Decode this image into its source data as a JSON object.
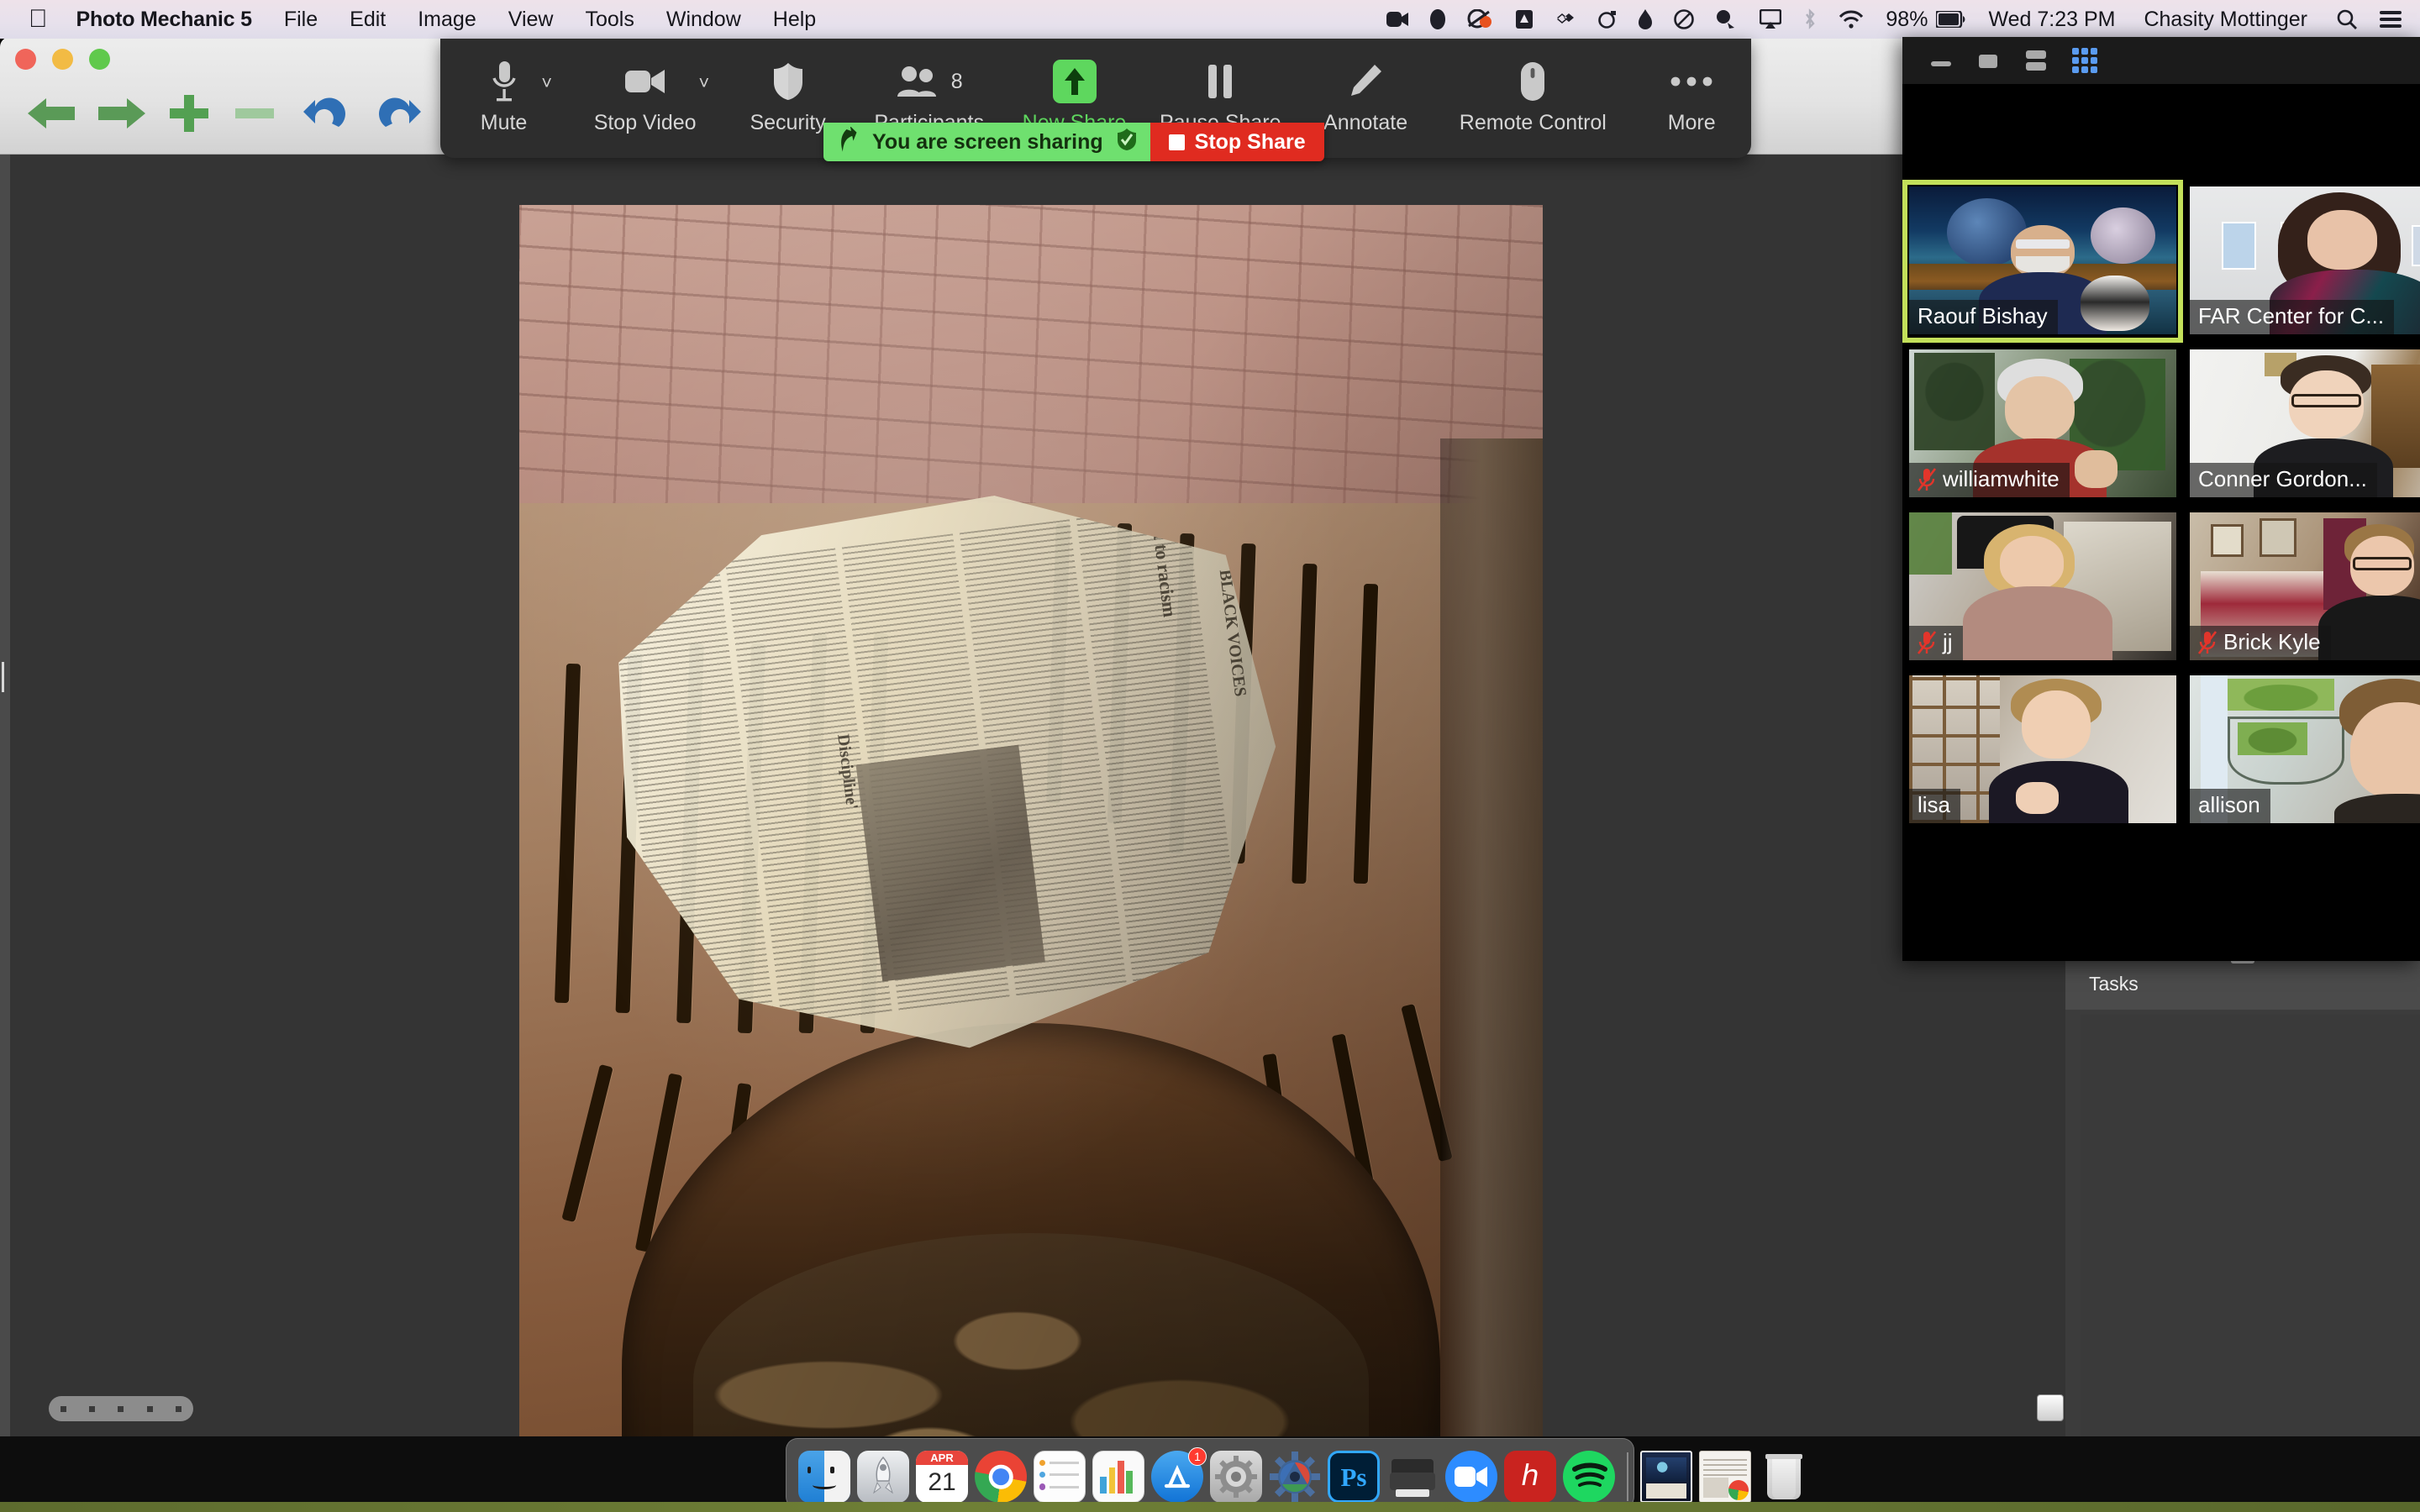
{
  "menubar": {
    "apple_icon": "apple-logo",
    "app_name": "Photo Mechanic 5",
    "menus": [
      "File",
      "Edit",
      "Image",
      "View",
      "Tools",
      "Window",
      "Help"
    ],
    "status_icons": [
      "zoom-meeting-icon",
      "1password-icon",
      "cloud-sync-icon",
      "dropbox-icon",
      "dropbox-alt-icon",
      "timer-icon",
      "flame-icon",
      "backblaze-icon",
      "helper-icon",
      "airplay-icon",
      "bluetooth-icon",
      "wifi-icon"
    ],
    "battery_percent": "98%",
    "battery_icon": "battery-icon",
    "datetime": "Wed 7:23 PM",
    "user_name": "Chasity Mottinger",
    "search_icon": "search-icon",
    "control_center_icon": "control-center-icon"
  },
  "photo_mechanic": {
    "window_buttons": [
      "close-button",
      "minimize-button",
      "zoom-button"
    ],
    "toolbar_icons": [
      "previous-arrow-icon",
      "next-arrow-icon",
      "add-icon",
      "remove-icon",
      "rotate-left-icon",
      "rotate-right-icon",
      "info-icon",
      "crop-icon",
      "color-class-red-icon",
      "color-class-red-lines-icon",
      "color-class-orange-dark-icon",
      "color-class-orange-light-icon"
    ],
    "tasks_panel": {
      "title": "Tasks"
    },
    "photo": {
      "newspaper_headlines": [
        "BLACK VOICES",
        "react to racism",
        "Discipline'"
      ]
    }
  },
  "zoom_toolbar": {
    "items": [
      {
        "label": "Mute",
        "icon": "microphone-icon",
        "has_caret": true,
        "active": false
      },
      {
        "label": "Stop Video",
        "icon": "video-camera-icon",
        "has_caret": true,
        "active": false
      },
      {
        "label": "Security",
        "icon": "shield-icon",
        "has_caret": false,
        "active": false
      },
      {
        "label": "Participants",
        "icon": "participants-icon",
        "has_caret": false,
        "badge": "8",
        "active": false
      },
      {
        "label": "New Share",
        "icon": "up-arrow-share-icon",
        "has_caret": false,
        "active": true
      },
      {
        "label": "Pause Share",
        "icon": "pause-icon",
        "has_caret": false,
        "active": false
      },
      {
        "label": "Annotate",
        "icon": "pencil-icon",
        "has_caret": false,
        "active": false
      },
      {
        "label": "Remote Control",
        "icon": "mouse-icon",
        "has_caret": false,
        "active": false
      },
      {
        "label": "More",
        "icon": "ellipsis-icon",
        "has_caret": false,
        "active": false
      }
    ],
    "accent_green": "#5ed75e"
  },
  "share_banner": {
    "sharing_text": "You are screen sharing",
    "shield_icon": "green-shield-check-icon",
    "share_arrow_icon": "share-arrow-icon",
    "stop_label": "Stop Share",
    "stop_icon": "stop-square-icon",
    "green": "#6fe06f",
    "red": "#e02b20"
  },
  "zoom_window": {
    "controls": [
      {
        "name": "minimize-button",
        "icon": "minimize-icon",
        "active": false
      },
      {
        "name": "maximize-button",
        "icon": "maximize-icon",
        "active": false
      },
      {
        "name": "speaker-view-button",
        "icon": "speaker-view-icon",
        "active": false
      },
      {
        "name": "gallery-view-button",
        "icon": "gallery-view-icon",
        "active": true
      }
    ],
    "active_accent": "#5a9bf0",
    "active_speaker_border": "#c3e05a",
    "participants": [
      {
        "name": "Raouf Bishay",
        "muted": false,
        "active_speaker": true
      },
      {
        "name": "FAR Center for C...",
        "muted": false,
        "active_speaker": false
      },
      {
        "name": "williamwhite",
        "muted": true,
        "active_speaker": false
      },
      {
        "name": "Conner Gordon...",
        "muted": false,
        "active_speaker": false
      },
      {
        "name": "jj",
        "muted": true,
        "active_speaker": false
      },
      {
        "name": "Brick Kyle",
        "muted": true,
        "active_speaker": false
      },
      {
        "name": "lisa",
        "muted": false,
        "active_speaker": false
      },
      {
        "name": "allison",
        "muted": false,
        "active_speaker": false
      }
    ]
  },
  "dock": {
    "items": [
      {
        "name": "finder",
        "label": "Finder",
        "running": true,
        "badge": null
      },
      {
        "name": "launchpad",
        "label": "Launchpad",
        "running": false,
        "badge": null
      },
      {
        "name": "calendar",
        "label": "Calendar",
        "running": false,
        "badge": null,
        "month": "APR",
        "day": "21"
      },
      {
        "name": "google-chrome",
        "label": "Google Chrome",
        "running": true,
        "badge": null
      },
      {
        "name": "notes",
        "label": "Notes",
        "running": false,
        "badge": null
      },
      {
        "name": "numbers",
        "label": "Numbers",
        "running": false,
        "badge": null
      },
      {
        "name": "app-store",
        "label": "App Store",
        "running": false,
        "badge": "1"
      },
      {
        "name": "system-preferences",
        "label": "System Preferences",
        "running": true,
        "badge": null
      },
      {
        "name": "photo-mechanic",
        "label": "Photo Mechanic 5",
        "running": true,
        "badge": null
      },
      {
        "name": "photoshop",
        "label": "Adobe Photoshop",
        "running": false,
        "badge": null
      },
      {
        "name": "printer",
        "label": "Printer",
        "running": false,
        "badge": null
      },
      {
        "name": "zoom",
        "label": "zoom.us",
        "running": true,
        "badge": null
      },
      {
        "name": "adobe-acrobat",
        "label": "Adobe Acrobat",
        "running": true,
        "badge": null
      },
      {
        "name": "spotify",
        "label": "Spotify",
        "running": true,
        "badge": null
      }
    ],
    "stack_items": [
      {
        "name": "downloads-stack",
        "label": "Downloads"
      },
      {
        "name": "documents-stack",
        "label": "Documents"
      }
    ],
    "trash": {
      "name": "trash",
      "label": "Trash"
    }
  }
}
